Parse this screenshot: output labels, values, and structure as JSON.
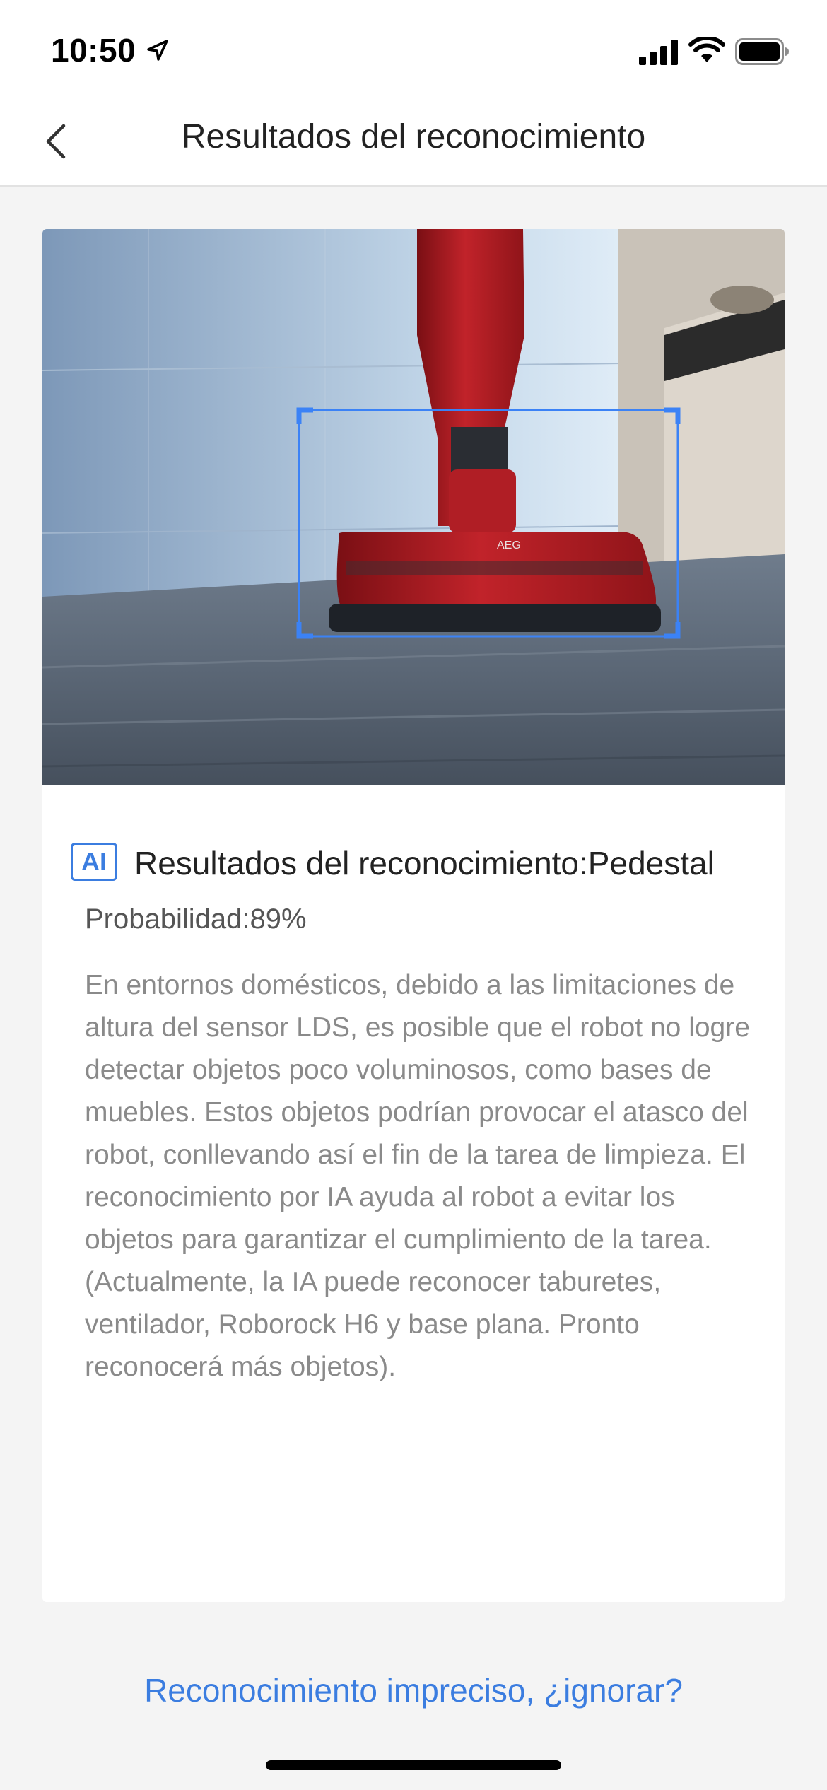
{
  "status_bar": {
    "time": "10:50"
  },
  "nav": {
    "title": "Resultados del reconocimiento"
  },
  "result": {
    "badge": "AI",
    "label": "Resultados del reconocimiento:Pedestal",
    "probability": "Probabilidad:89%",
    "description": "En entornos domésticos, debido a las limitaciones de altura del sensor LDS, es posible que el robot no logre detectar objetos poco voluminosos, como bases de muebles. Estos objetos podrían provocar el atasco del robot, conllevando así el fin de la tarea de limpieza. El reconocimiento por IA ayuda al robot a evitar los objetos para garantizar el cumplimiento de la tarea. (Actualmente, la IA puede reconocer taburetes, ventilador, Roborock H6 y base plana. Pronto reconocerá más objetos)."
  },
  "photo": {
    "vacuum_brand": "AEG"
  },
  "footer": {
    "ignore_link": "Reconocimiento impreciso, ¿ignorar?"
  },
  "colors": {
    "accent": "#3b7de0",
    "background": "#f4f4f4"
  }
}
